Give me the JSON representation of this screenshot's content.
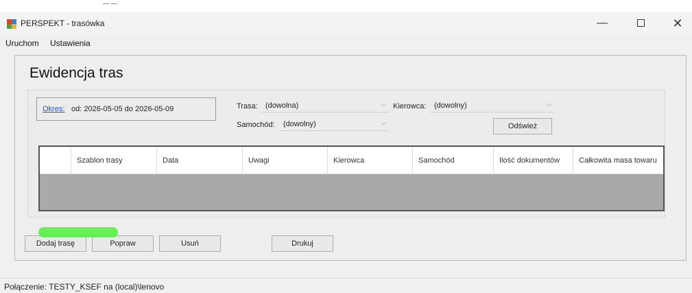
{
  "window": {
    "title": "PERSPEKT - trasówka",
    "min_glyph": "—",
    "close_glyph": "✕"
  },
  "menu": [
    "Uruchom",
    "Ustawienia"
  ],
  "page": {
    "heading": "Ewidencja tras"
  },
  "period": {
    "link_label": "Okres:",
    "range": "od: 2026-05-05 do 2026-05-09"
  },
  "filters": {
    "route_label": "Trasa:",
    "route_value": "(dowolna)",
    "driver_label": "Kierowca:",
    "driver_value": "(dowolny)",
    "car_label": "Samochód:",
    "car_value": "(dowolny)",
    "refresh_label": "Odśwież"
  },
  "table": {
    "columns": [
      "Szablon trasy",
      "Data",
      "Uwagi",
      "Kierowca",
      "Samochód",
      "Ilość dokumentów",
      "Całkowita masa towaru"
    ],
    "rows": []
  },
  "actions": {
    "add": "Dodaj trasę",
    "edit": "Popraw",
    "delete": "Usuń",
    "print": "Drukuj"
  },
  "status": {
    "connection": "Połączenie: TESTY_KSEF na (local)\\lenovo"
  },
  "colors": {
    "accent_highlight": "#4ef23a",
    "link": "#1a4fd6",
    "grid_background": "#a9a9a9"
  }
}
